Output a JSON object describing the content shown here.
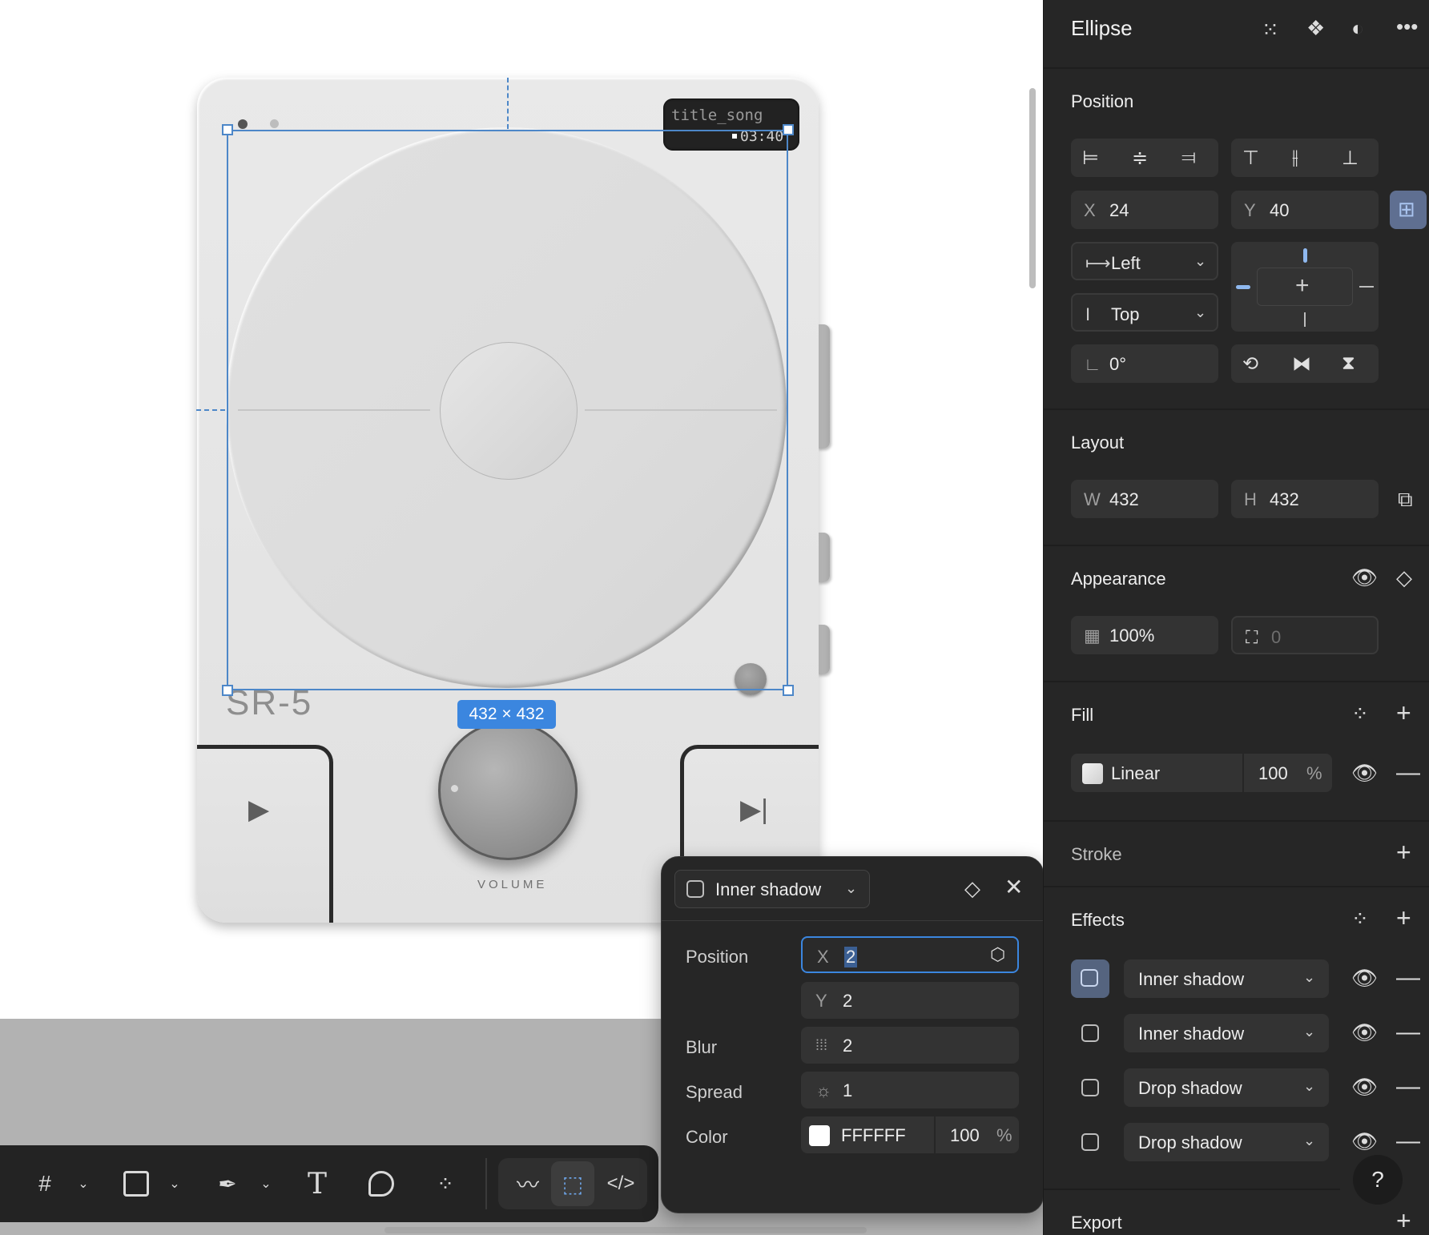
{
  "canvas": {
    "screen_title": "title_song",
    "screen_time": "03:40",
    "model_label": "SR-5",
    "volume_label": "VOLUME",
    "selection_size": "432 × 432"
  },
  "toolbar": {
    "tools": [
      "frame-icon",
      "rectangle-icon",
      "pen-icon",
      "text-icon",
      "comment-icon",
      "components-icon",
      "draw-icon",
      "design-mode-icon",
      "code-icon"
    ],
    "active_tool": "design-mode-icon"
  },
  "popover": {
    "type_label": "Inner shadow",
    "position_label": "Position",
    "x_prefix": "X",
    "x_value": "2",
    "y_prefix": "Y",
    "y_value": "2",
    "blur_label": "Blur",
    "blur_value": "2",
    "spread_label": "Spread",
    "spread_value": "1",
    "color_label": "Color",
    "color_hex": "FFFFFF",
    "color_opacity": "100",
    "percent": "%"
  },
  "panel": {
    "title": "Ellipse",
    "position": {
      "title": "Position",
      "x_prefix": "X",
      "x": "24",
      "y_prefix": "Y",
      "y": "40",
      "h_constraint": "Left",
      "v_constraint": "Top",
      "rotation": "0°"
    },
    "layout": {
      "title": "Layout",
      "w_prefix": "W",
      "w": "432",
      "h_prefix": "H",
      "h": "432"
    },
    "appearance": {
      "title": "Appearance",
      "opacity": "100%",
      "radius": "0"
    },
    "fill": {
      "title": "Fill",
      "type": "Linear",
      "opacity": "100",
      "percent": "%"
    },
    "stroke": {
      "title": "Stroke"
    },
    "effects": {
      "title": "Effects",
      "items": [
        {
          "label": "Inner shadow"
        },
        {
          "label": "Inner shadow"
        },
        {
          "label": "Drop shadow"
        },
        {
          "label": "Drop shadow"
        }
      ]
    },
    "export": {
      "title": "Export"
    },
    "help": "?"
  },
  "colors": {
    "accent": "#3b86df",
    "selection": "#4d87c8",
    "panel_bg": "#262626",
    "field_bg": "#333333"
  }
}
